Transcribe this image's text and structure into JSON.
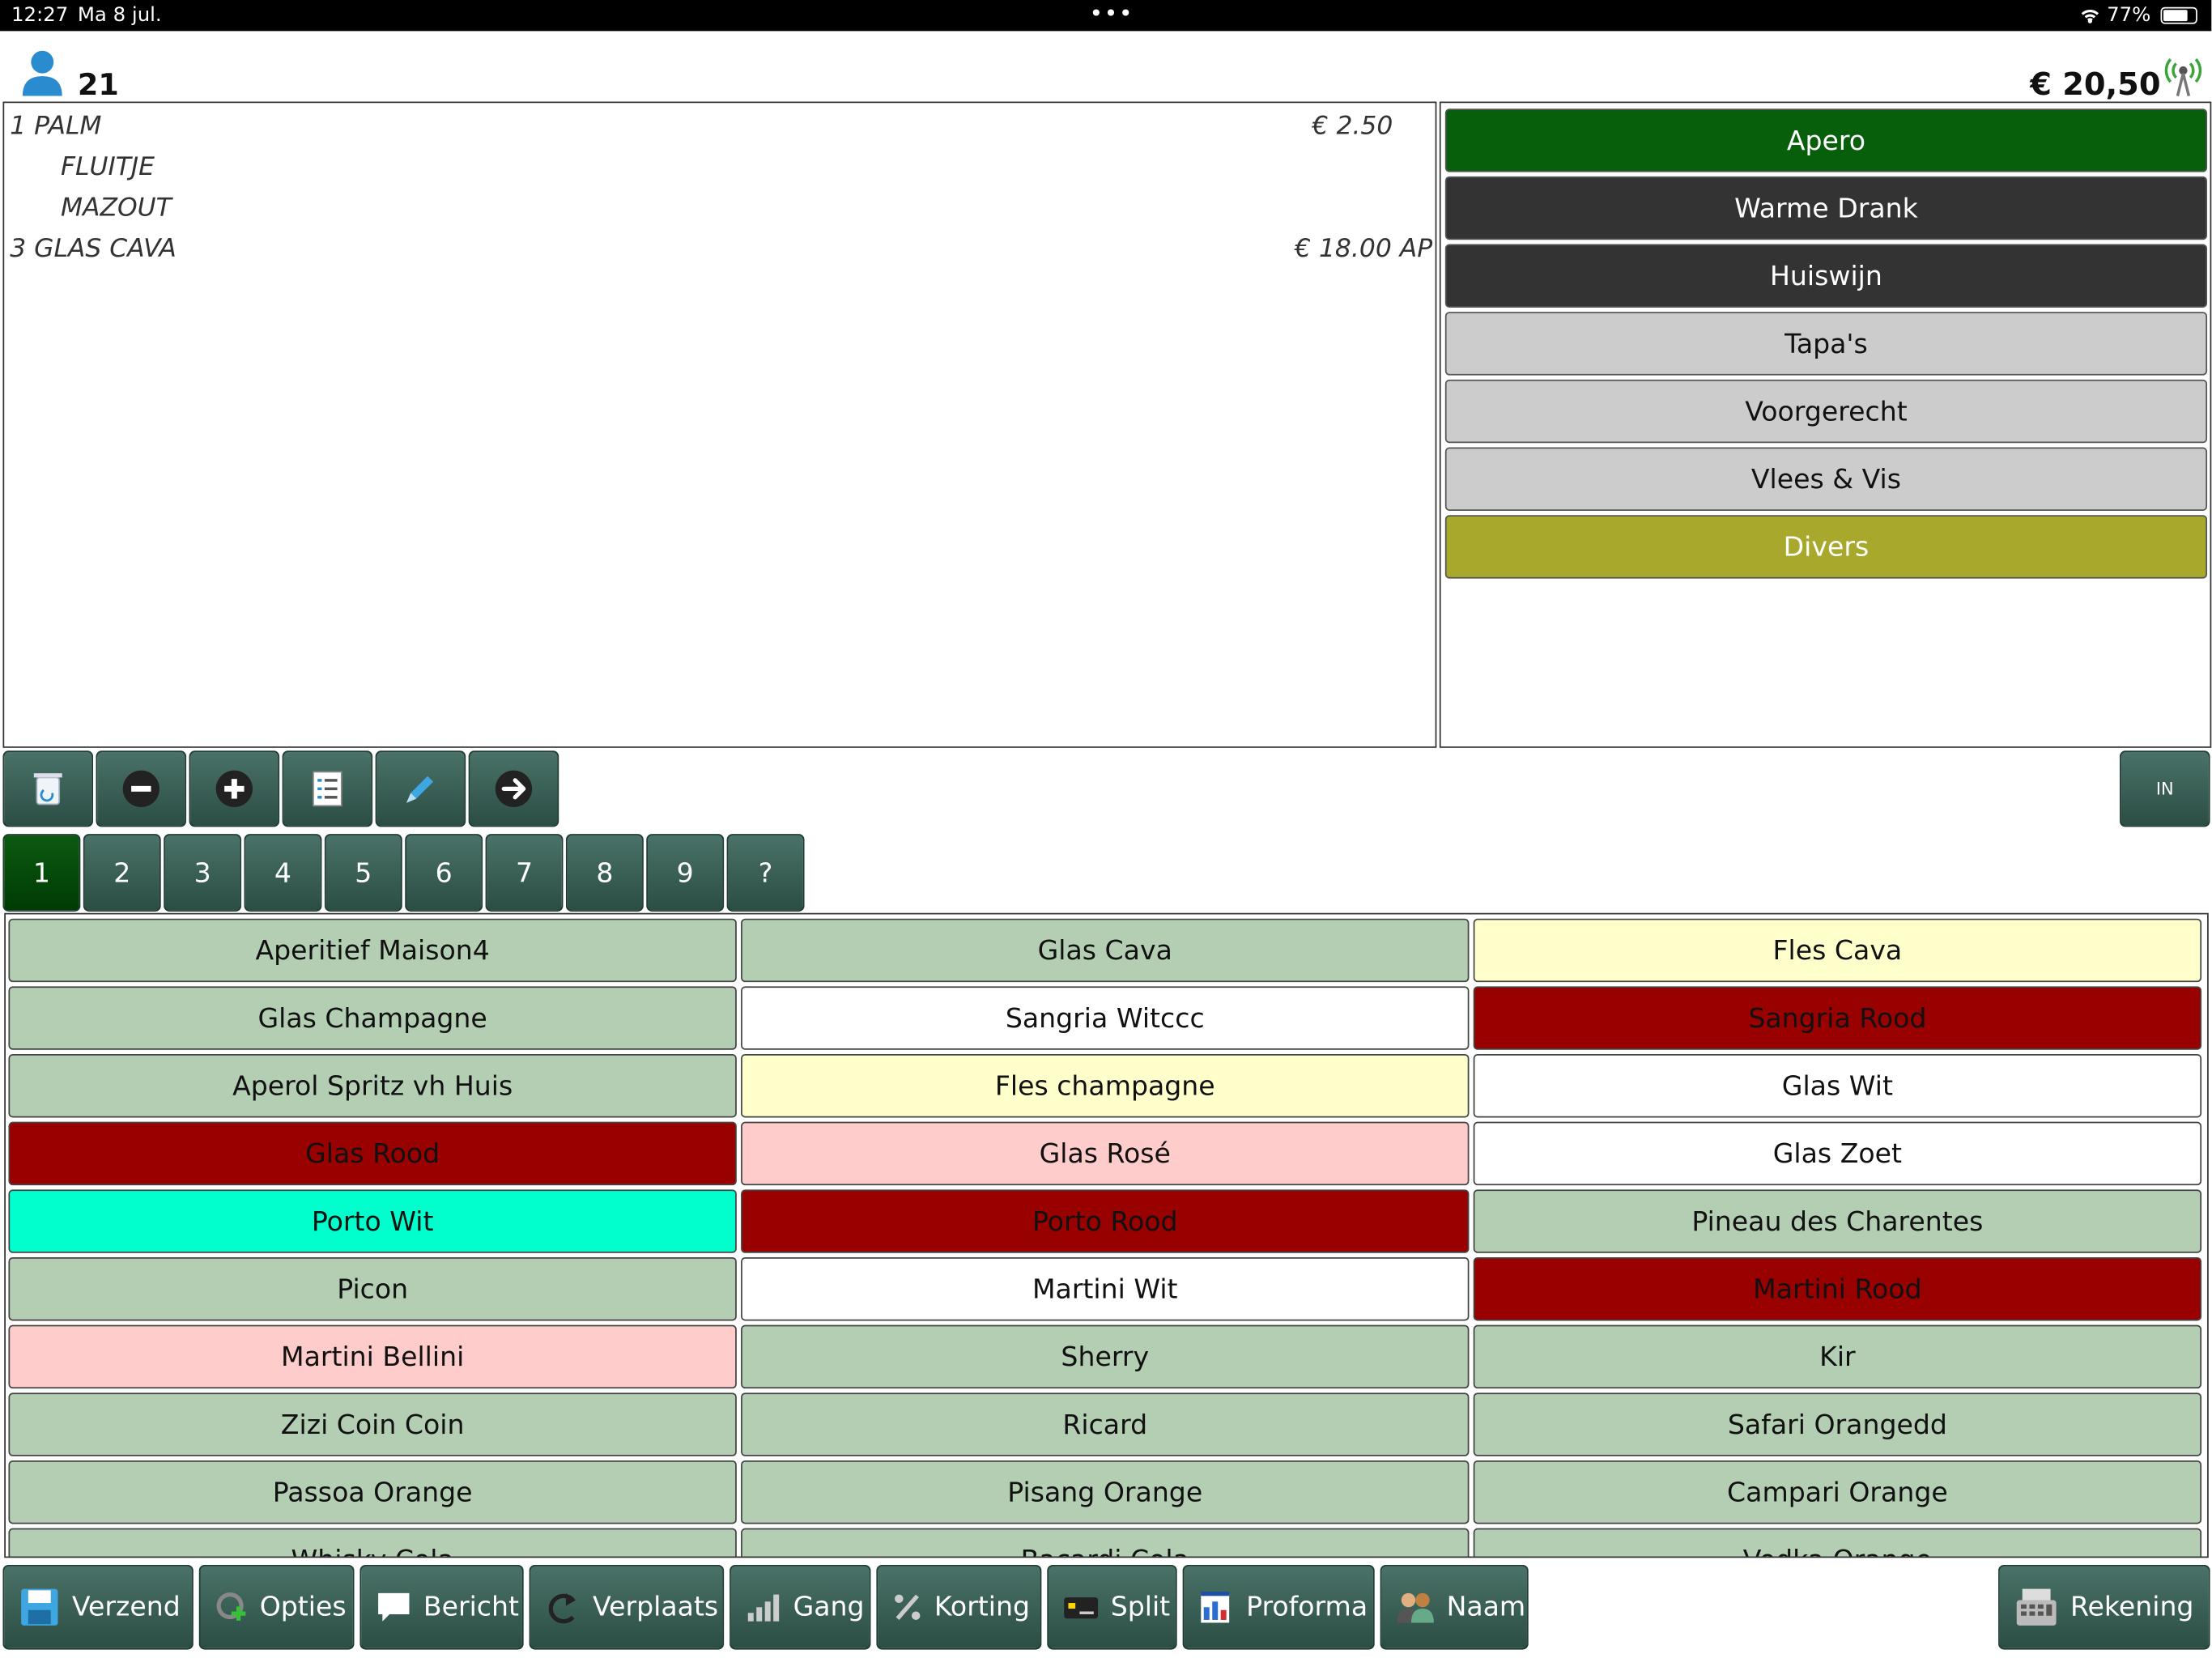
{
  "status": {
    "time": "12:27",
    "date": "Ma 8 jul.",
    "dots": "•••",
    "battery": "77%",
    "battery_level": 0.77
  },
  "header": {
    "covers": "21",
    "total": "€ 20,50"
  },
  "order": {
    "lines": [
      {
        "name": "1 PALM",
        "price": "€ 2.50",
        "sub": false
      },
      {
        "name": "FLUITJE",
        "price": "",
        "sub": true
      },
      {
        "name": "MAZOUT",
        "price": "",
        "sub": true
      },
      {
        "name": "3 GLAS CAVA",
        "price": "€ 18.00 AP",
        "sub": false
      }
    ]
  },
  "categories": [
    {
      "label": "Apero",
      "bg": "#075e0b",
      "fg": "#ffffff"
    },
    {
      "label": "Warme Drank",
      "bg": "#333333",
      "fg": "#ffffff"
    },
    {
      "label": "Huiswijn",
      "bg": "#333333",
      "fg": "#ffffff"
    },
    {
      "label": "Tapa's",
      "bg": "#cccccc",
      "fg": "#111111"
    },
    {
      "label": "Voorgerecht",
      "bg": "#cccccc",
      "fg": "#111111"
    },
    {
      "label": "Vlees & Vis",
      "bg": "#cccccc",
      "fg": "#111111"
    },
    {
      "label": "Divers",
      "bg": "#a8a82c",
      "fg": "#ffffff"
    }
  ],
  "toolbar": {
    "in_label": "IN"
  },
  "courses": [
    "1",
    "2",
    "3",
    "4",
    "5",
    "6",
    "7",
    "8",
    "9",
    "?"
  ],
  "products": [
    {
      "label": "Aperitief Maison4",
      "bg": "#b3ceb3",
      "fg": "#111"
    },
    {
      "label": "Glas Cava",
      "bg": "#b3ceb3",
      "fg": "#111"
    },
    {
      "label": "Fles Cava",
      "bg": "#ffffcc",
      "fg": "#111"
    },
    {
      "label": "Glas Champagne",
      "bg": "#b3ceb3",
      "fg": "#111"
    },
    {
      "label": "Sangria Witccc",
      "bg": "#ffffff",
      "fg": "#111"
    },
    {
      "label": "Sangria Rood",
      "bg": "#990000",
      "fg": "#111"
    },
    {
      "label": "Aperol Spritz vh Huis",
      "bg": "#b3ceb3",
      "fg": "#111"
    },
    {
      "label": "Fles champagne",
      "bg": "#ffffcc",
      "fg": "#111"
    },
    {
      "label": "Glas Wit",
      "bg": "#ffffff",
      "fg": "#111"
    },
    {
      "label": "Glas Rood",
      "bg": "#990000",
      "fg": "#111"
    },
    {
      "label": "Glas Rosé",
      "bg": "#ffcccc",
      "fg": "#111"
    },
    {
      "label": "Glas Zoet",
      "bg": "#ffffff",
      "fg": "#111"
    },
    {
      "label": "Porto Wit",
      "bg": "#00ffcc",
      "fg": "#111"
    },
    {
      "label": "Porto Rood",
      "bg": "#990000",
      "fg": "#111"
    },
    {
      "label": "Pineau des Charentes",
      "bg": "#b3ceb3",
      "fg": "#111"
    },
    {
      "label": "Picon",
      "bg": "#b3ceb3",
      "fg": "#111"
    },
    {
      "label": "Martini Wit",
      "bg": "#ffffff",
      "fg": "#111"
    },
    {
      "label": "Martini Rood",
      "bg": "#990000",
      "fg": "#111"
    },
    {
      "label": "Martini Bellini",
      "bg": "#ffcccc",
      "fg": "#111"
    },
    {
      "label": "Sherry",
      "bg": "#b3ceb3",
      "fg": "#111"
    },
    {
      "label": "Kir",
      "bg": "#b3ceb3",
      "fg": "#111"
    },
    {
      "label": "Zizi Coin Coin",
      "bg": "#b3ceb3",
      "fg": "#111"
    },
    {
      "label": "Ricard",
      "bg": "#b3ceb3",
      "fg": "#111"
    },
    {
      "label": "Safari Orangedd",
      "bg": "#b3ceb3",
      "fg": "#111"
    },
    {
      "label": "Passoa Orange",
      "bg": "#b3ceb3",
      "fg": "#111"
    },
    {
      "label": "Pisang Orange",
      "bg": "#b3ceb3",
      "fg": "#111"
    },
    {
      "label": "Campari Orange",
      "bg": "#b3ceb3",
      "fg": "#111"
    },
    {
      "label": "Whisky Cola",
      "bg": "#b3ceb3",
      "fg": "#111"
    },
    {
      "label": "Bacardi Cola",
      "bg": "#b3ceb3",
      "fg": "#111"
    },
    {
      "label": "Vodka Orange",
      "bg": "#b3ceb3",
      "fg": "#111"
    }
  ],
  "bottom": {
    "verzend": "Verzend",
    "opties": "Opties",
    "bericht": "Bericht",
    "verplaats": "Verplaats",
    "gang": "Gang",
    "korting": "Korting",
    "split": "Split",
    "proforma": "Proforma",
    "naam": "Naam",
    "rekening": "Rekening"
  },
  "icons": {
    "user": "user-icon",
    "signal": "signal-icon",
    "wifi": "wifi-icon",
    "trash": "trash-icon",
    "minus": "minus-icon",
    "plus": "plus-icon",
    "list": "list-icon",
    "edit": "pencil-icon",
    "arrow": "arrow-right-icon"
  },
  "colors": {
    "tool_button": "#3a6157",
    "active_course": "#075e0b"
  }
}
